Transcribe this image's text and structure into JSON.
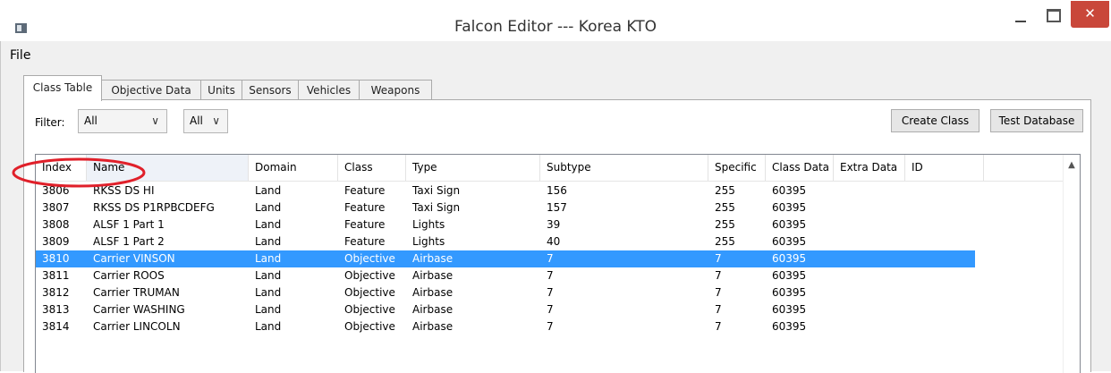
{
  "window": {
    "title": "Falcon Editor --- Korea KTO",
    "close_glyph": "✕"
  },
  "menu": {
    "file_label": "File"
  },
  "tabs": [
    {
      "label": "Class Table",
      "active": true
    },
    {
      "label": "Objective Data",
      "active": false
    },
    {
      "label": "Units",
      "active": false
    },
    {
      "label": "Sensors",
      "active": false
    },
    {
      "label": "Vehicles",
      "active": false
    },
    {
      "label": "Weapons",
      "active": false
    }
  ],
  "toolbar": {
    "filter_label": "Filter:",
    "filter_value_1": "All",
    "filter_value_2": "All",
    "create_class_label": "Create Class",
    "test_database_label": "Test Database"
  },
  "table": {
    "columns": [
      "Index",
      "Name",
      "Domain",
      "Class",
      "Type",
      "Subtype",
      "Specific",
      "Class Data",
      "Extra Data",
      "ID"
    ],
    "rows": [
      [
        "3806",
        "RKSS DS HI",
        "Land",
        "Feature",
        "Taxi Sign",
        "156",
        "255",
        "60395"
      ],
      [
        "3807",
        "RKSS DS P1RPBCDEFG",
        "Land",
        "Feature",
        "Taxi Sign",
        "157",
        "255",
        "60395"
      ],
      [
        "3808",
        "ALSF 1 Part 1",
        "Land",
        "Feature",
        "Lights",
        "39",
        "255",
        "60395"
      ],
      [
        "3809",
        "ALSF 1 Part 2",
        "Land",
        "Feature",
        "Lights",
        "40",
        "255",
        "60395"
      ],
      [
        "3810",
        "Carrier VINSON",
        "Land",
        "Objective",
        "Airbase",
        "7",
        "7",
        "60395"
      ],
      [
        "3811",
        "Carrier ROOS",
        "Land",
        "Objective",
        "Airbase",
        "7",
        "7",
        "60395"
      ],
      [
        "3812",
        "Carrier TRUMAN",
        "Land",
        "Objective",
        "Airbase",
        "7",
        "7",
        "60395"
      ],
      [
        "3813",
        "Carrier WASHING",
        "Land",
        "Objective",
        "Airbase",
        "7",
        "7",
        "60395"
      ],
      [
        "3814",
        "Carrier LINCOLN",
        "Land",
        "Objective",
        "Airbase",
        "7",
        "7",
        "60395"
      ]
    ],
    "selected_row": 4
  },
  "colors": {
    "selection": "#3399ff",
    "close_button": "#c9473a",
    "annotation": "#e0202a"
  }
}
